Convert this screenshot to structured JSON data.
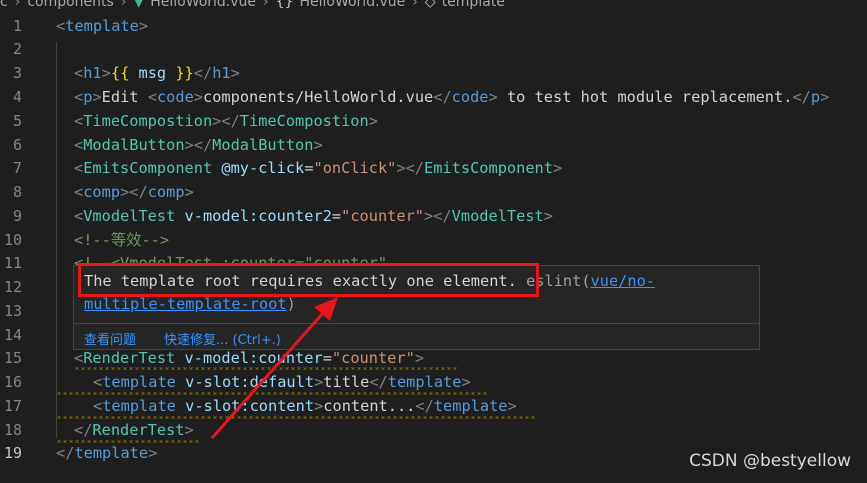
{
  "breadcrumb": {
    "items": [
      "c",
      "components",
      "HelloWorld.vue",
      "HelloWorld.vue",
      "template"
    ]
  },
  "editor": {
    "active_line": 19,
    "lines": [
      {
        "n": "1",
        "text": "<template>"
      },
      {
        "n": "2",
        "text": ""
      },
      {
        "n": "3",
        "text": "<h1>{{ msg }}</h1>"
      },
      {
        "n": "4",
        "text": "<p>Edit <code>components/HelloWorld.vue</code> to test hot module replacement.</p>"
      },
      {
        "n": "5",
        "text": "<TimeCompostion></TimeCompostion>"
      },
      {
        "n": "6",
        "text": "<ModalButton></ModalButton>"
      },
      {
        "n": "7",
        "text": "<EmitsComponent @my-click=\"onClick\"></EmitsComponent>"
      },
      {
        "n": "8",
        "text": "<comp></comp>"
      },
      {
        "n": "9",
        "text": "<VmodelTest v-model:counter2=\"counter\"></VmodelTest>"
      },
      {
        "n": "10",
        "text": "<!--等效-->"
      },
      {
        "n": "11",
        "text": "<!--<VmodelTest :counter=\"counter\""
      },
      {
        "n": "12",
        "text": ""
      },
      {
        "n": "13",
        "text": ""
      },
      {
        "n": "14",
        "text": ""
      },
      {
        "n": "15",
        "text": "<RenderTest v-model:counter=\"counter\">"
      },
      {
        "n": "16",
        "text": "<template v-slot:default>title</template>"
      },
      {
        "n": "17",
        "text": "<template v-slot:content>content...</template>"
      },
      {
        "n": "18",
        "text": "</RenderTest>"
      },
      {
        "n": "19",
        "text": "</template>"
      }
    ]
  },
  "hover": {
    "message": "The template root requires exactly one element.",
    "source": "eslint(",
    "rule_part1": "vue/no-",
    "rule_part2": "multiple-template-root",
    "close_paren": ")",
    "action_view": "查看问题",
    "action_fix": "快速修复... (Ctrl+.)"
  },
  "colors": {
    "background": "#1e1e1e",
    "tag": "#569cd6",
    "component": "#4ec9b0",
    "attribute": "#9cdcfe",
    "string": "#ce9178",
    "comment": "#6a9955",
    "annotation_red": "#e8151b",
    "warning_squiggle": "#cca700",
    "link": "#3794ff"
  },
  "icons": [
    "vue-file-icon",
    "braces-icon",
    "template-tag-icon"
  ],
  "watermark": "CSDN @bestyellow"
}
